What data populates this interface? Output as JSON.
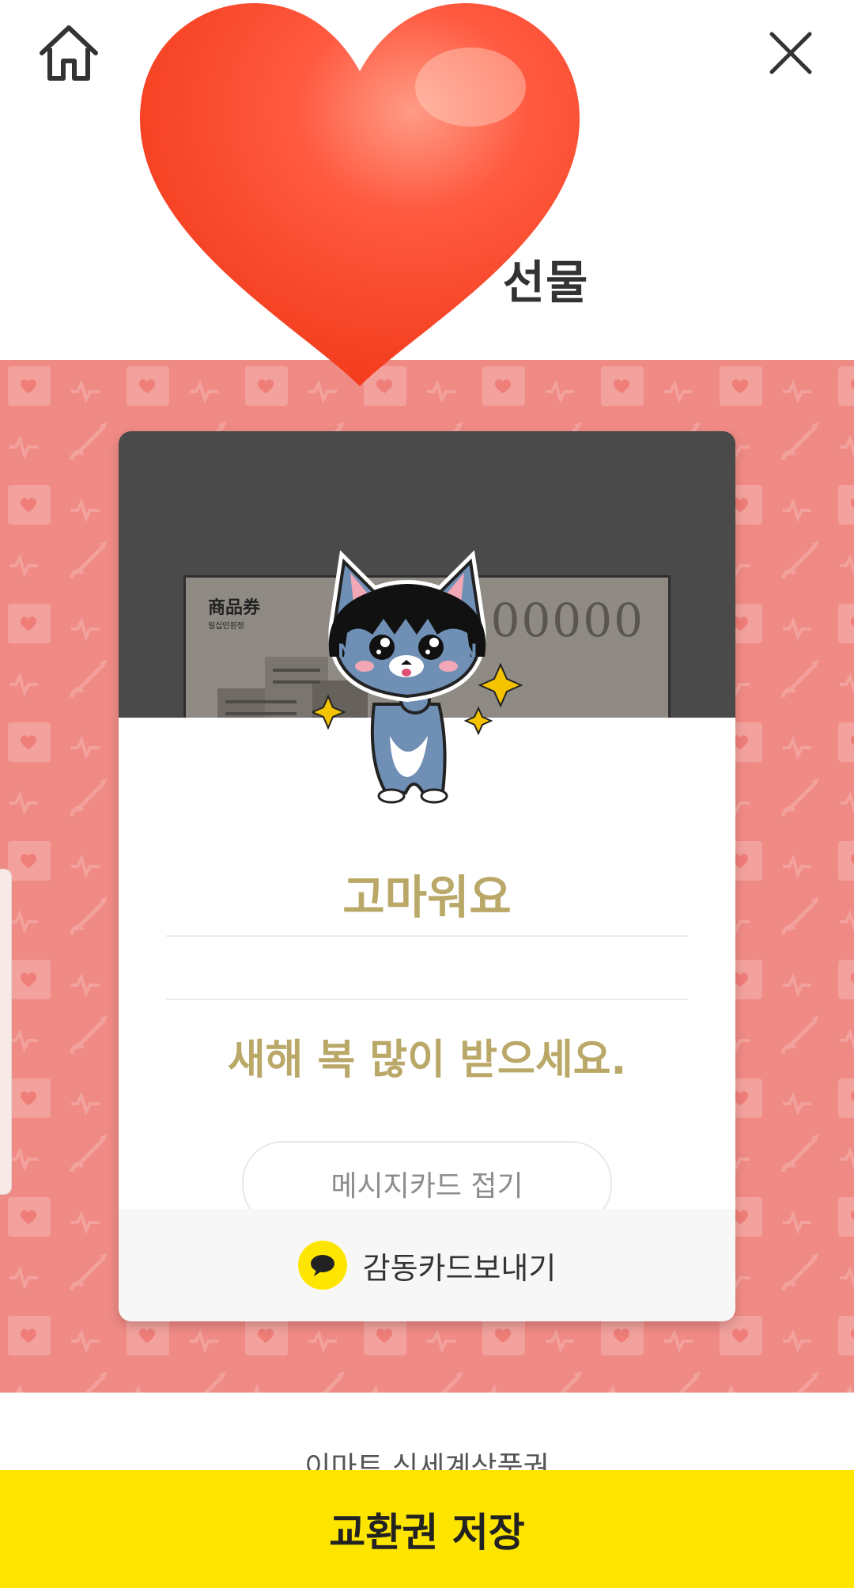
{
  "header": {
    "title": "선물",
    "home_icon": "home-icon",
    "close_icon": "close-icon"
  },
  "voucher": {
    "title": "商品券",
    "subtitle": "일십만원정",
    "amount": "00000"
  },
  "message_card": {
    "title": "고마워요",
    "body": "새해 복 많이 받으세요.",
    "fold_button": "메시지카드 접기",
    "send_label": "감동카드보내기"
  },
  "product": {
    "name": "이마트 신세계상품권"
  },
  "bottom_bar": {
    "save_label": "교환권 저장"
  },
  "colors": {
    "pattern_bg": "#f08a85",
    "kakao_yellow": "#fee500",
    "message_text": "#b9a867"
  }
}
